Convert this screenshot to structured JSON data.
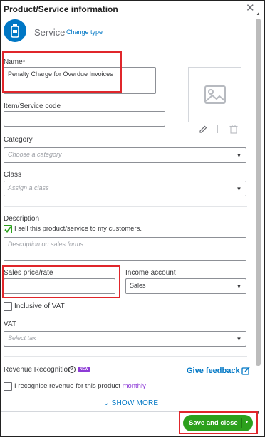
{
  "panel": {
    "title": "Product/Service information",
    "type_name": "Service",
    "change_type": "Change type"
  },
  "name": {
    "label": "Name*",
    "value": "Penalty Charge for Overdue Invoices"
  },
  "item_code": {
    "label": "Item/Service code",
    "value": ""
  },
  "category": {
    "label": "Category",
    "placeholder": "Choose a category"
  },
  "class": {
    "label": "Class",
    "placeholder": "Assign a class"
  },
  "description": {
    "label": "Description",
    "sell_checkbox_label": "I sell this product/service to my customers.",
    "sell_checked": true,
    "placeholder": "Description on sales forms"
  },
  "sales_price": {
    "label": "Sales price/rate",
    "value": ""
  },
  "income_account": {
    "label": "Income account",
    "value": "Sales"
  },
  "inclusive_vat": {
    "label": "Inclusive of VAT",
    "checked": false
  },
  "vat": {
    "label": "VAT",
    "placeholder": "Select tax"
  },
  "revenue": {
    "label": "Revenue Recognition",
    "badge": "NEW",
    "checkbox_label": "I recognise revenue for this product",
    "checkbox_link": "monthly"
  },
  "give_feedback": "Give feedback",
  "show_more": "SHOW MORE",
  "save_button": "Save and close",
  "colors": {
    "primary": "#0077c5",
    "green": "#2ca01c",
    "highlight": "#e0262b",
    "purple": "#8d3bd6"
  }
}
